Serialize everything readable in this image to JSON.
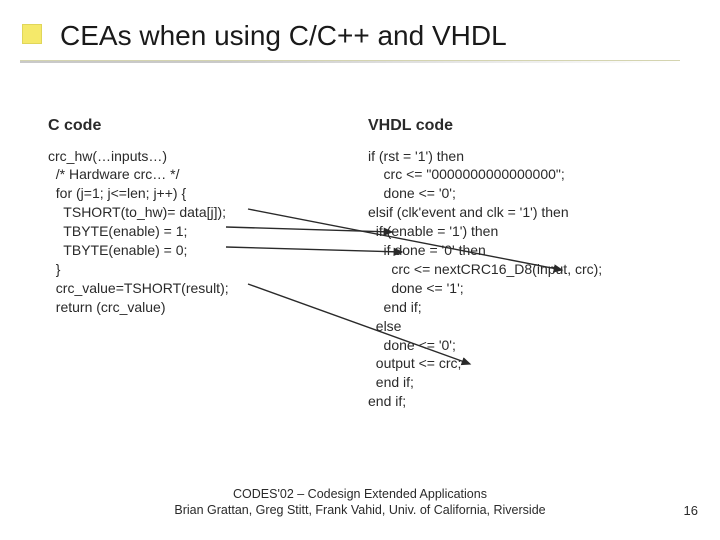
{
  "title": "CEAs when using C/C++ and VHDL",
  "left": {
    "heading": "C code",
    "l1": "crc_hw(…inputs…)",
    "l2": "  /* Hardware crc… */",
    "l3": "  for (j=1; j<=len; j++) {",
    "l4": "    TSHORT(to_hw)= data[j]);",
    "l5": "    TBYTE(enable) = 1;",
    "l6": "    TBYTE(enable) = 0;",
    "l7": "  }",
    "l8": "  crc_value=TSHORT(result);",
    "l9": "  return (crc_value)"
  },
  "right": {
    "heading": "VHDL code",
    "l1": "if (rst = '1') then",
    "l2": "    crc <= \"0000000000000000\";",
    "l3": "    done <= '0';",
    "l4": "elsif (clk'event and clk = '1') then",
    "l5": "  if (enable = '1') then",
    "l6": "    if done = '0' then",
    "l7": "      crc <= nextCRC16_D8(input, crc);",
    "l8": "      done <= '1';",
    "l9": "    end if;",
    "l10": "  else",
    "l11": "    done <= '0';",
    "l12": "  output <= crc;",
    "l13": "  end if;",
    "l14": "end if;"
  },
  "footer_line1": "CODES'02 – Codesign Extended Applications",
  "footer_line2": "Brian Grattan, Greg Stitt, Frank Vahid, Univ. of California, Riverside",
  "page_number": "16"
}
